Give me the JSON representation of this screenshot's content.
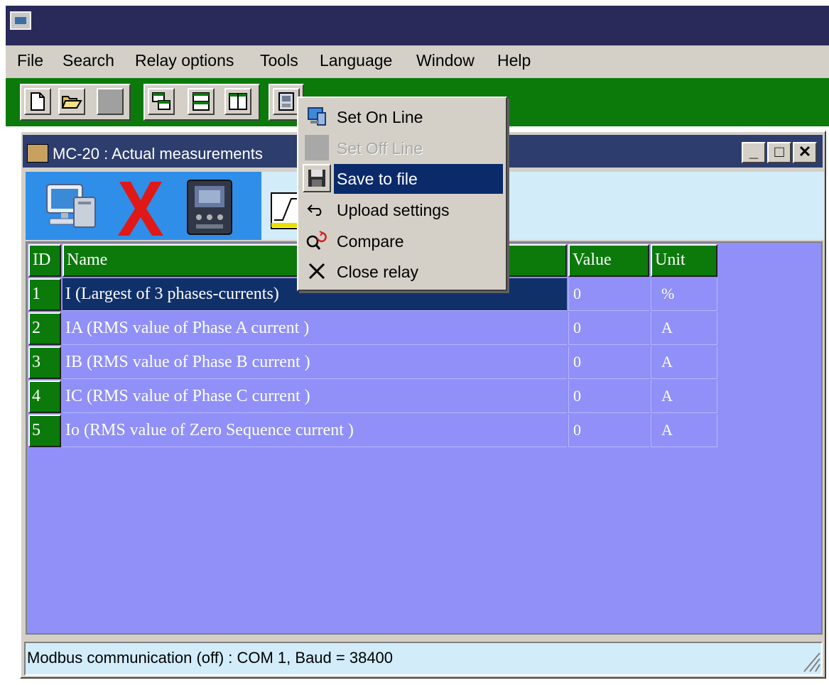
{
  "window": {
    "title": ""
  },
  "menubar": {
    "items": [
      {
        "label": "File"
      },
      {
        "label": "Search"
      },
      {
        "label": "Relay options"
      },
      {
        "label": "Tools"
      },
      {
        "label": "Language"
      },
      {
        "label": "Window"
      },
      {
        "label": "Help"
      }
    ]
  },
  "toolbar": {
    "buttons": [
      "new-file-icon",
      "open-folder-icon",
      "blank-icon",
      "cascade-icon",
      "tile-horizontal-icon",
      "tile-vertical-icon",
      "relay-window-icon"
    ]
  },
  "child_window": {
    "title": "MC-20 : Actual measurements",
    "controls": {
      "minimize": "_",
      "maximize": "□",
      "close": "✕"
    }
  },
  "context_menu": {
    "items": [
      {
        "label": "Set On Line",
        "icon": "online-computer-icon",
        "enabled": true
      },
      {
        "label": "Set Off Line",
        "icon": "blank-icon",
        "enabled": false
      },
      {
        "label": "Save to file",
        "icon": "floppy-disk-icon",
        "enabled": true,
        "highlighted": true
      },
      {
        "label": "Upload settings",
        "icon": "undo-arrow-icon",
        "enabled": true
      },
      {
        "label": "Compare",
        "icon": "compare-magnifier-icon",
        "enabled": true
      },
      {
        "label": "Close relay",
        "icon": "close-x-icon",
        "enabled": true
      }
    ]
  },
  "table": {
    "headers": {
      "id": "ID",
      "name": "Name",
      "value": "Value",
      "unit": "Unit"
    },
    "rows": [
      {
        "id": "1",
        "name": "I (Largest of 3 phases-currents)",
        "value": "0",
        "unit": "%"
      },
      {
        "id": "2",
        "name": "IA (RMS value of Phase A current )",
        "value": "0",
        "unit": "A"
      },
      {
        "id": "3",
        "name": "IB (RMS value of Phase B current )",
        "value": "0",
        "unit": "A"
      },
      {
        "id": "4",
        "name": "IC (RMS value of Phase C current )",
        "value": "0",
        "unit": "A"
      },
      {
        "id": "5",
        "name": "Io (RMS value of Zero Sequence current )",
        "value": "0",
        "unit": "A"
      }
    ],
    "selected_row": 1
  },
  "statusbar": {
    "text": "Modbus communication (off) : COM 1, Baud = 38400"
  },
  "colors": {
    "toolbar_green": "#0b7a0b",
    "grid_bg": "#9090f8",
    "highlight": "#0a2a6a",
    "title_blue": "#2d3d6e"
  }
}
